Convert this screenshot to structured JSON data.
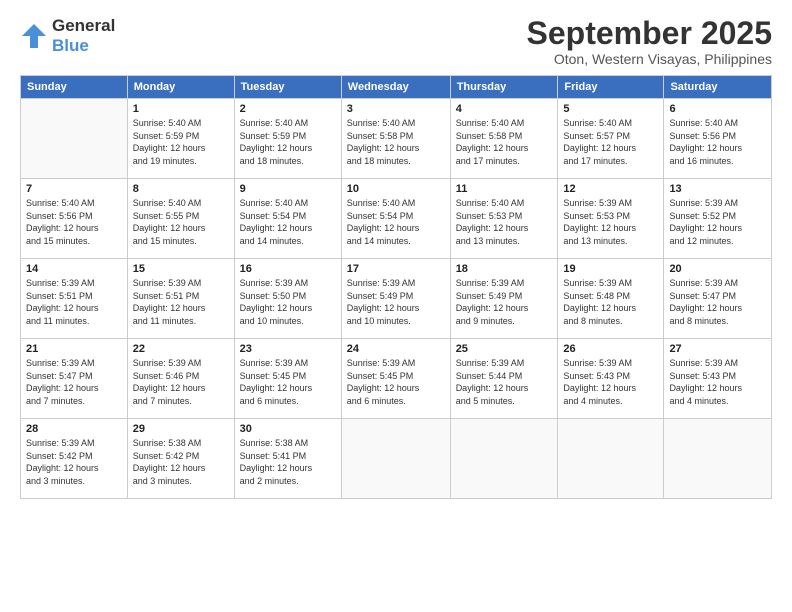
{
  "logo": {
    "line1": "General",
    "line2": "Blue"
  },
  "title": "September 2025",
  "subtitle": "Oton, Western Visayas, Philippines",
  "days_of_week": [
    "Sunday",
    "Monday",
    "Tuesday",
    "Wednesday",
    "Thursday",
    "Friday",
    "Saturday"
  ],
  "weeks": [
    [
      {
        "day": "",
        "info": ""
      },
      {
        "day": "1",
        "info": "Sunrise: 5:40 AM\nSunset: 5:59 PM\nDaylight: 12 hours\nand 19 minutes."
      },
      {
        "day": "2",
        "info": "Sunrise: 5:40 AM\nSunset: 5:59 PM\nDaylight: 12 hours\nand 18 minutes."
      },
      {
        "day": "3",
        "info": "Sunrise: 5:40 AM\nSunset: 5:58 PM\nDaylight: 12 hours\nand 18 minutes."
      },
      {
        "day": "4",
        "info": "Sunrise: 5:40 AM\nSunset: 5:58 PM\nDaylight: 12 hours\nand 17 minutes."
      },
      {
        "day": "5",
        "info": "Sunrise: 5:40 AM\nSunset: 5:57 PM\nDaylight: 12 hours\nand 17 minutes."
      },
      {
        "day": "6",
        "info": "Sunrise: 5:40 AM\nSunset: 5:56 PM\nDaylight: 12 hours\nand 16 minutes."
      }
    ],
    [
      {
        "day": "7",
        "info": "Sunrise: 5:40 AM\nSunset: 5:56 PM\nDaylight: 12 hours\nand 15 minutes."
      },
      {
        "day": "8",
        "info": "Sunrise: 5:40 AM\nSunset: 5:55 PM\nDaylight: 12 hours\nand 15 minutes."
      },
      {
        "day": "9",
        "info": "Sunrise: 5:40 AM\nSunset: 5:54 PM\nDaylight: 12 hours\nand 14 minutes."
      },
      {
        "day": "10",
        "info": "Sunrise: 5:40 AM\nSunset: 5:54 PM\nDaylight: 12 hours\nand 14 minutes."
      },
      {
        "day": "11",
        "info": "Sunrise: 5:40 AM\nSunset: 5:53 PM\nDaylight: 12 hours\nand 13 minutes."
      },
      {
        "day": "12",
        "info": "Sunrise: 5:39 AM\nSunset: 5:53 PM\nDaylight: 12 hours\nand 13 minutes."
      },
      {
        "day": "13",
        "info": "Sunrise: 5:39 AM\nSunset: 5:52 PM\nDaylight: 12 hours\nand 12 minutes."
      }
    ],
    [
      {
        "day": "14",
        "info": "Sunrise: 5:39 AM\nSunset: 5:51 PM\nDaylight: 12 hours\nand 11 minutes."
      },
      {
        "day": "15",
        "info": "Sunrise: 5:39 AM\nSunset: 5:51 PM\nDaylight: 12 hours\nand 11 minutes."
      },
      {
        "day": "16",
        "info": "Sunrise: 5:39 AM\nSunset: 5:50 PM\nDaylight: 12 hours\nand 10 minutes."
      },
      {
        "day": "17",
        "info": "Sunrise: 5:39 AM\nSunset: 5:49 PM\nDaylight: 12 hours\nand 10 minutes."
      },
      {
        "day": "18",
        "info": "Sunrise: 5:39 AM\nSunset: 5:49 PM\nDaylight: 12 hours\nand 9 minutes."
      },
      {
        "day": "19",
        "info": "Sunrise: 5:39 AM\nSunset: 5:48 PM\nDaylight: 12 hours\nand 8 minutes."
      },
      {
        "day": "20",
        "info": "Sunrise: 5:39 AM\nSunset: 5:47 PM\nDaylight: 12 hours\nand 8 minutes."
      }
    ],
    [
      {
        "day": "21",
        "info": "Sunrise: 5:39 AM\nSunset: 5:47 PM\nDaylight: 12 hours\nand 7 minutes."
      },
      {
        "day": "22",
        "info": "Sunrise: 5:39 AM\nSunset: 5:46 PM\nDaylight: 12 hours\nand 7 minutes."
      },
      {
        "day": "23",
        "info": "Sunrise: 5:39 AM\nSunset: 5:45 PM\nDaylight: 12 hours\nand 6 minutes."
      },
      {
        "day": "24",
        "info": "Sunrise: 5:39 AM\nSunset: 5:45 PM\nDaylight: 12 hours\nand 6 minutes."
      },
      {
        "day": "25",
        "info": "Sunrise: 5:39 AM\nSunset: 5:44 PM\nDaylight: 12 hours\nand 5 minutes."
      },
      {
        "day": "26",
        "info": "Sunrise: 5:39 AM\nSunset: 5:43 PM\nDaylight: 12 hours\nand 4 minutes."
      },
      {
        "day": "27",
        "info": "Sunrise: 5:39 AM\nSunset: 5:43 PM\nDaylight: 12 hours\nand 4 minutes."
      }
    ],
    [
      {
        "day": "28",
        "info": "Sunrise: 5:39 AM\nSunset: 5:42 PM\nDaylight: 12 hours\nand 3 minutes."
      },
      {
        "day": "29",
        "info": "Sunrise: 5:38 AM\nSunset: 5:42 PM\nDaylight: 12 hours\nand 3 minutes."
      },
      {
        "day": "30",
        "info": "Sunrise: 5:38 AM\nSunset: 5:41 PM\nDaylight: 12 hours\nand 2 minutes."
      },
      {
        "day": "",
        "info": ""
      },
      {
        "day": "",
        "info": ""
      },
      {
        "day": "",
        "info": ""
      },
      {
        "day": "",
        "info": ""
      }
    ]
  ]
}
